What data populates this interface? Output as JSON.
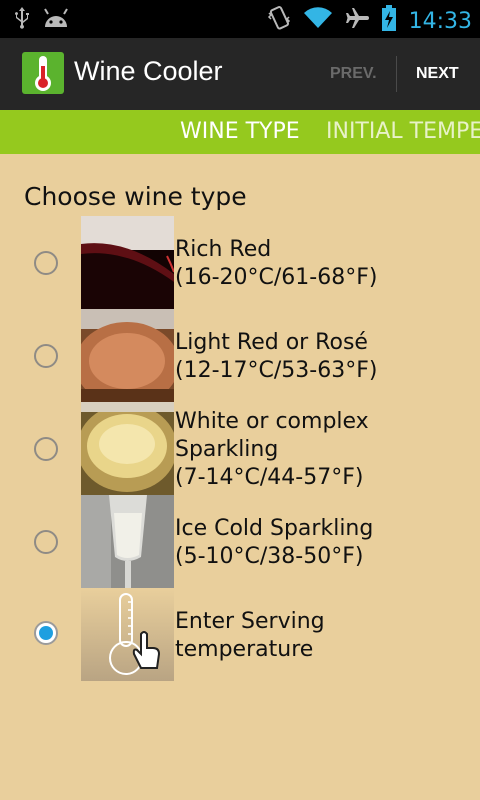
{
  "status_bar": {
    "time": "14:33",
    "icons": [
      "usb-icon",
      "android-debug-icon",
      "vibrate-icon",
      "wifi-icon",
      "airplane-icon",
      "battery-charging-icon"
    ]
  },
  "action_bar": {
    "title": "Wine Cooler",
    "prev_label": "PREV.",
    "next_label": "NEXT"
  },
  "tabs": {
    "items": [
      "WINE TYPE",
      "INITIAL TEMPE"
    ],
    "selected": "WINE TYPE",
    "accent": "#95c91e"
  },
  "main": {
    "heading": "Choose wine type",
    "options": [
      {
        "line1": "Rich Red",
        "line2": "(16-20°C/61-68°F)",
        "line3": "",
        "checked": false
      },
      {
        "line1": "Light Red or Rosé",
        "line2": "(12-17°C/53-63°F)",
        "line3": "",
        "checked": false
      },
      {
        "line1": "White or complex",
        "line2": "Sparkling",
        "line3": "(7-14°C/44-57°F)",
        "checked": false
      },
      {
        "line1": "Ice Cold Sparkling",
        "line2": "(5-10°C/38-50°F)",
        "line3": "",
        "checked": false
      },
      {
        "line1": "Enter Serving",
        "line2": "temperature",
        "line3": "",
        "checked": true
      }
    ]
  },
  "colors": {
    "background": "#e9cf9c",
    "radio_selected": "#1e9fe0"
  }
}
